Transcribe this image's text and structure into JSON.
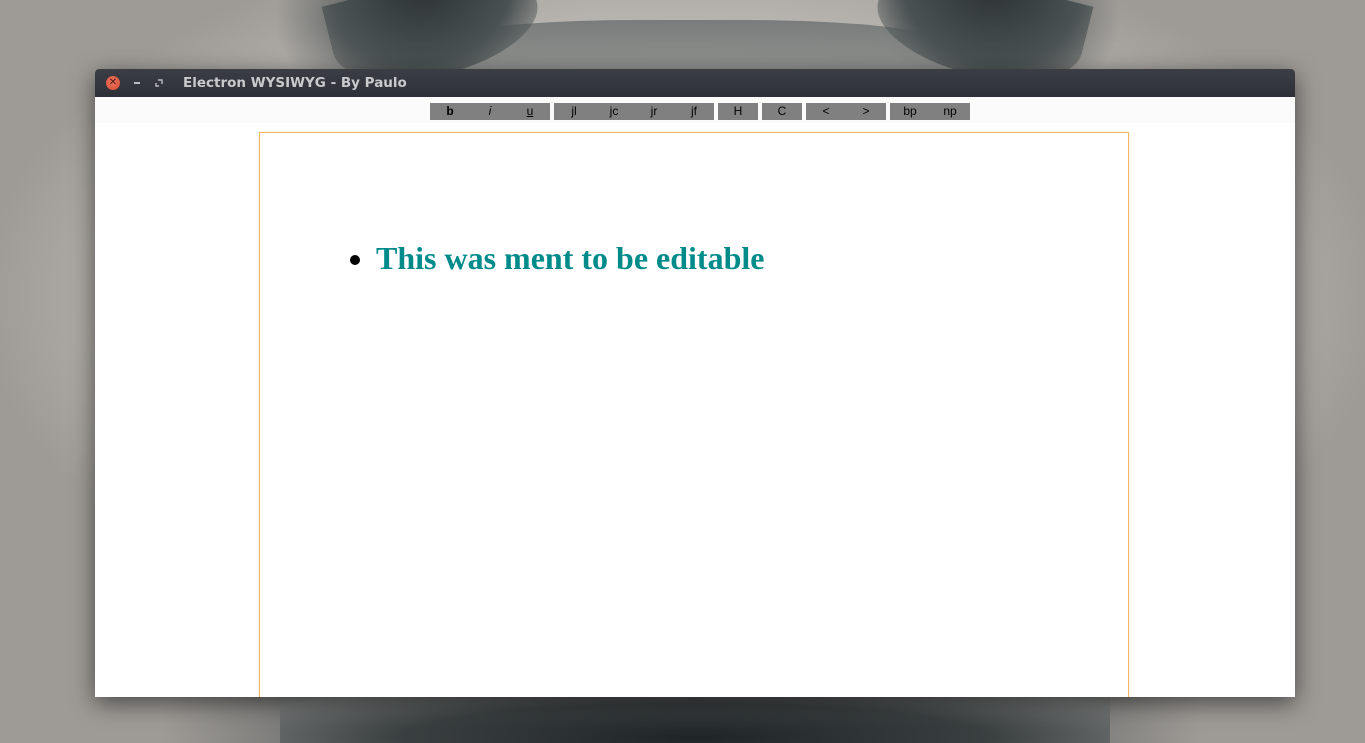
{
  "window": {
    "title": "Electron WYSIWYG - By Paulo"
  },
  "toolbar": {
    "groups": [
      [
        {
          "label": "b"
        },
        {
          "label": "i"
        },
        {
          "label": "u"
        }
      ],
      [
        {
          "label": "jl"
        },
        {
          "label": "jc"
        },
        {
          "label": "jr"
        },
        {
          "label": "jf"
        }
      ],
      [
        {
          "label": "H"
        }
      ],
      [
        {
          "label": "C"
        }
      ],
      [
        {
          "label": "<"
        },
        {
          "label": ">"
        }
      ],
      [
        {
          "label": "bp"
        },
        {
          "label": "np"
        }
      ]
    ]
  },
  "document": {
    "items": [
      "This was ment to be editable"
    ]
  },
  "colors": {
    "title_bar": "#2d3036",
    "close_button": "#d24b34",
    "toolbar_button_bg": "#808080",
    "page_border": "#efb862",
    "heading_text": "#008b8b"
  }
}
